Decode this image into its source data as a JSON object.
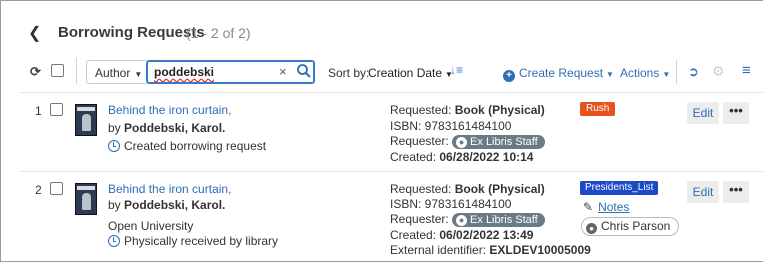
{
  "header": {
    "back_icon": "chevron-left-icon",
    "title": "Borrowing Requests",
    "count": "(1 - 2 of 2)"
  },
  "toolbar": {
    "refresh_icon": "refresh-icon",
    "author_label": "Author",
    "search_value": "poddebski",
    "clear_icon": "×",
    "sort_by_label": "Sort by:",
    "sort_value": "Creation Date",
    "create_request_label": "Create Request",
    "actions_label": "Actions",
    "accent_color": "#2f6db5"
  },
  "rows": [
    {
      "num": "1",
      "title": "Behind the iron curtain,",
      "by_prefix": "by",
      "author": "Poddebski, Karol.",
      "status": "Created borrowing request",
      "requested_label": "Requested:",
      "requested_value": "Book (Physical)",
      "isbn": "ISBN: 9783161484100",
      "requester_label": "Requester:",
      "requester": "Ex Libris Staff",
      "created_label": "Created:",
      "created_value": "06/28/2022 10:14",
      "badge": "Rush",
      "badge_color": "#e6541b",
      "edit_label": "Edit",
      "more_label": "•••"
    },
    {
      "num": "2",
      "title": "Behind the iron curtain,",
      "by_prefix": "by",
      "author": "Poddebski, Karol.",
      "partner": "Open University",
      "status": "Physically received by library",
      "requested_label": "Requested:",
      "requested_value": "Book (Physical)",
      "isbn": "ISBN: 9783161484100",
      "requester_label": "Requester:",
      "requester": "Ex Libris Staff",
      "created_label": "Created:",
      "created_value": "06/02/2022 13:49",
      "external_label": "External identifier:",
      "external_value": "EXLDEV10005009",
      "badge": "Presidents_List",
      "badge_color": "#1c49c8",
      "notes_label": "Notes",
      "assignee": "Chris Parson",
      "edit_label": "Edit",
      "more_label": "•••"
    }
  ]
}
